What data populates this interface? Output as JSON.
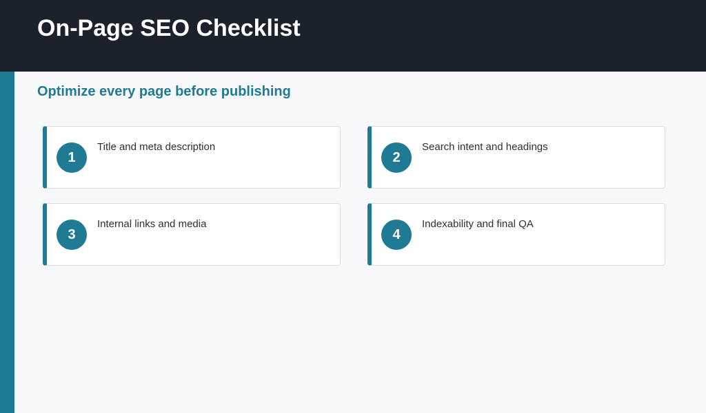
{
  "header": {
    "title": "On-Page SEO Checklist"
  },
  "subtitle": "Optimize every page before publishing",
  "checklist": [
    {
      "number": "1",
      "label": "Title and meta description"
    },
    {
      "number": "2",
      "label": "Search intent and headings"
    },
    {
      "number": "3",
      "label": "Internal links and media"
    },
    {
      "number": "4",
      "label": "Indexability and final QA"
    }
  ],
  "colors": {
    "header_bg": "#1b222b",
    "accent": "#1f7a94",
    "page_bg": "#f7f8fa",
    "card_bg": "#ffffff"
  }
}
